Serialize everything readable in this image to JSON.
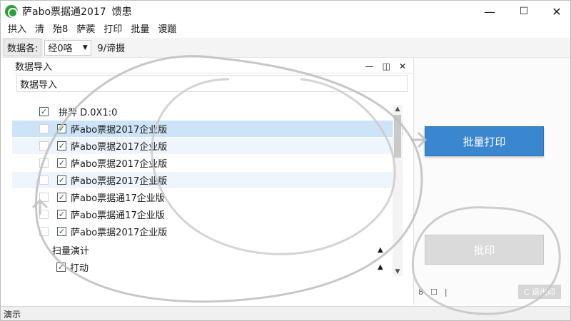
{
  "window": {
    "title": "萨abo票据通2017",
    "status": "馈患",
    "controls": {
      "minimize": "—",
      "maximize": "☐",
      "close": "✕"
    }
  },
  "menu": [
    "拱入",
    "清",
    "殆8",
    "萨蒺",
    "打印",
    "批量",
    "谡躐"
  ],
  "toolbar": {
    "label": "数据各:",
    "combo_value": "经0咯",
    "button": "9/谛摄"
  },
  "import_panel": {
    "title": "数据导入",
    "controls": [
      "—",
      "◫",
      "✕"
    ],
    "field_value": "数据导入",
    "tree_rows": [
      {
        "label": "拚羿 D.0X1:0",
        "checked": true,
        "outer": false
      },
      {
        "label": "萨abo票据2017企业版",
        "checked": true,
        "outer": true,
        "selected": true
      },
      {
        "label": "萨abo票据2017企业版",
        "checked": true,
        "outer": true,
        "alt": true
      },
      {
        "label": "萨abo票据2017企业版",
        "checked": true,
        "outer": true
      },
      {
        "label": "萨abo票据2017企业版",
        "checked": true,
        "outer": true,
        "alt": true
      },
      {
        "label": "萨abo票据通17企业版",
        "checked": true,
        "outer": true
      },
      {
        "label": "萨abo票据通17企业版",
        "checked": true,
        "outer": true
      },
      {
        "label": "萨abo票据2017企业版",
        "checked": true,
        "outer": true
      }
    ],
    "group": {
      "label": "扫量演计",
      "child_label": "打动",
      "child_checked": true
    }
  },
  "actions": {
    "batch_print": "批量打印",
    "print": "批印",
    "footer_icons": [
      "8",
      "☐",
      "|"
    ],
    "footer_button": "C 退出印"
  },
  "statusbar": {
    "text": "演示"
  },
  "colors": {
    "primary": "#3a86cf",
    "selection": "#cde3f7",
    "check": "#1f6d28"
  }
}
